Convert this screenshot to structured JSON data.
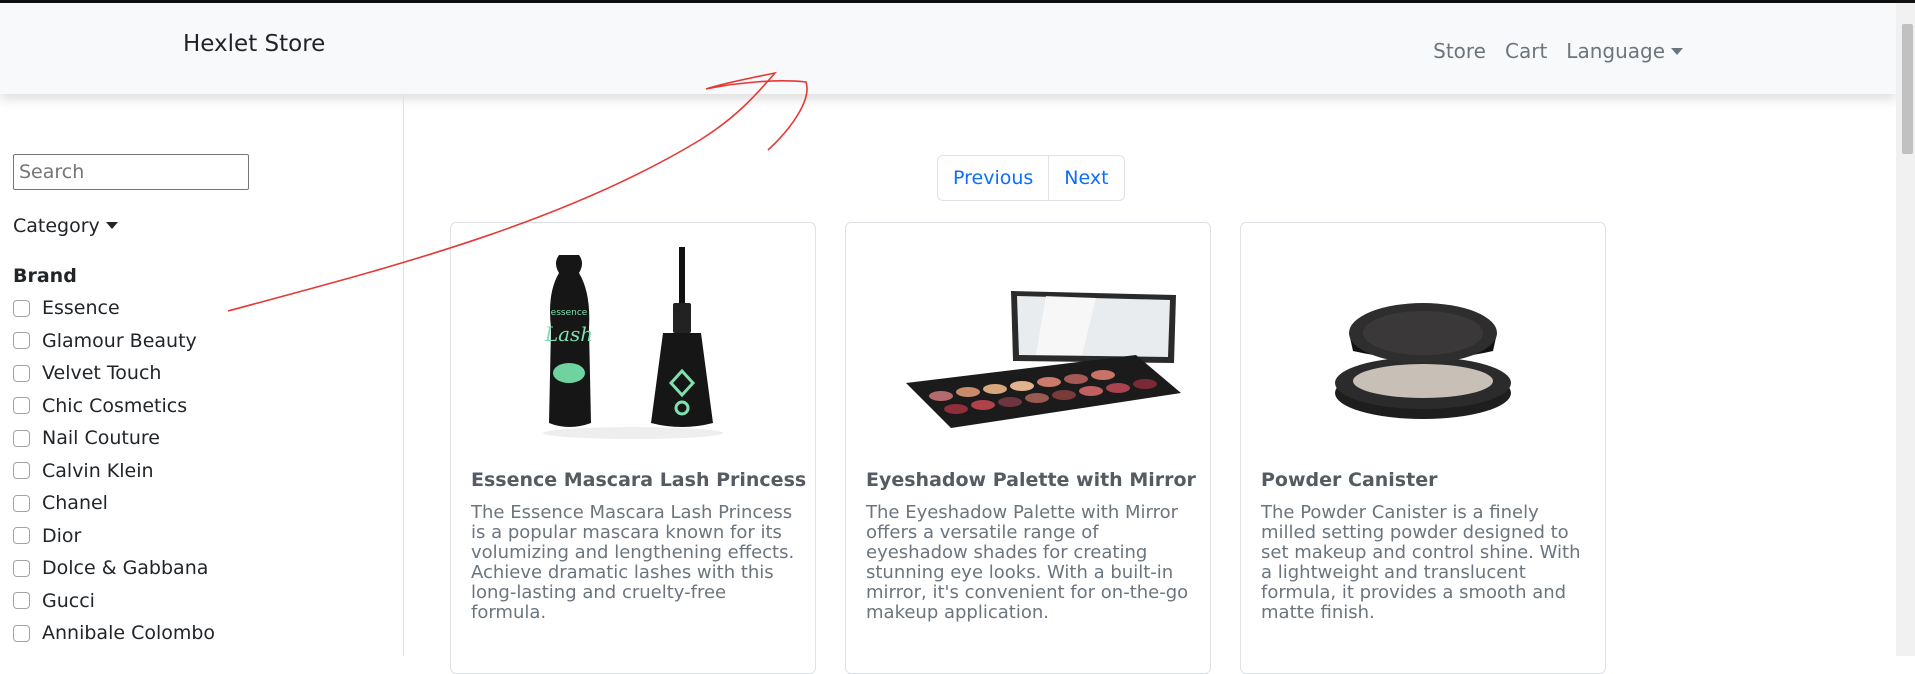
{
  "navbar": {
    "brand": "Hexlet Store",
    "links": [
      "Store",
      "Cart"
    ],
    "language_label": "Language"
  },
  "sidebar": {
    "search_placeholder": "Search",
    "category_label": "Category",
    "brand_title": "Brand",
    "brands": [
      "Essence",
      "Glamour Beauty",
      "Velvet Touch",
      "Chic Cosmetics",
      "Nail Couture",
      "Calvin Klein",
      "Chanel",
      "Dior",
      "Dolce & Gabbana",
      "Gucci",
      "Annibale Colombo"
    ]
  },
  "pagination": {
    "previous": "Previous",
    "next": "Next"
  },
  "products": [
    {
      "title": "Essence Mascara Lash Princess",
      "description": "The Essence Mascara Lash Princess is a popular mascara known for its volumizing and lengthening effects. Achieve dramatic lashes with this long-lasting and cruelty-free formula."
    },
    {
      "title": "Eyeshadow Palette with Mirror",
      "description": "The Eyeshadow Palette with Mirror offers a versatile range of eyeshadow shades for creating stunning eye looks. With a built-in mirror, it's convenient for on-the-go makeup application."
    },
    {
      "title": "Powder Canister",
      "description": "The Powder Canister is a finely milled setting powder designed to set makeup and control shine. With a lightweight and translucent formula, it provides a smooth and matte finish."
    }
  ],
  "product_images": [
    "mascara-icon",
    "eyeshadow-palette-icon",
    "powder-canister-icon"
  ],
  "colors": {
    "link": "#0d6efd",
    "navbar_bg": "#f8f9fa",
    "muted_text": "#6c757d",
    "annotation": "#e53935"
  }
}
